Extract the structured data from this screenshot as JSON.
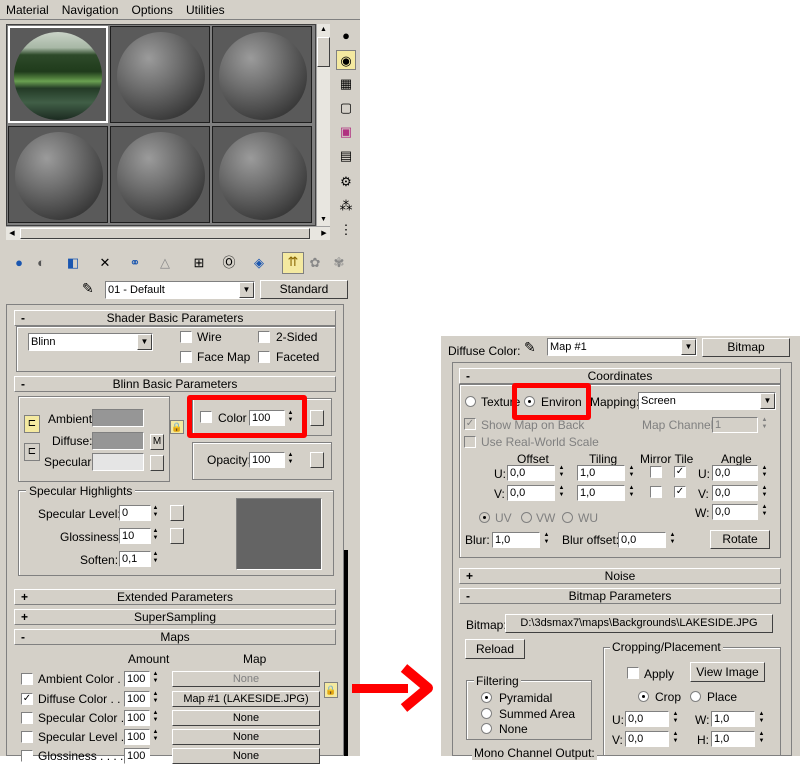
{
  "menu": [
    "Material",
    "Navigation",
    "Options",
    "Utilities"
  ],
  "material_name": "01 - Default",
  "material_type": "Standard",
  "shader_basic": {
    "title": "Shader Basic Parameters",
    "shader": "Blinn",
    "wire": "Wire",
    "two_sided": "2-Sided",
    "face_map": "Face Map",
    "faceted": "Faceted"
  },
  "blinn_basic": {
    "title": "Blinn Basic Parameters",
    "ambient": "Ambient:",
    "diffuse": "Diffuse:",
    "specular": "Specular:",
    "m_label": "M",
    "self_illum_label": "Color",
    "self_illum_value": "100",
    "opacity_label": "Opacity:",
    "opacity_value": "100",
    "colors": {
      "ambient": "#969696",
      "diffuse": "#969696",
      "specular": "#e5e5e5",
      "highlight": "#646464"
    }
  },
  "specular_highlights": {
    "title": "Specular Highlights",
    "level_label": "Specular Level:",
    "level": "0",
    "gloss_label": "Glossiness:",
    "gloss": "10",
    "soften_label": "Soften:",
    "soften": "0,1"
  },
  "rollouts": {
    "extended": "Extended Parameters",
    "supersampling": "SuperSampling",
    "maps": "Maps"
  },
  "maps": {
    "amount_header": "Amount",
    "map_header": "Map",
    "rows": [
      {
        "label": "Ambient Color . .",
        "checked": false,
        "amount": "100",
        "map": "None",
        "map_disabled": true
      },
      {
        "label": "Diffuse Color . . .",
        "checked": true,
        "amount": "100",
        "map": "Map #1 (LAKESIDE.JPG)",
        "map_disabled": false
      },
      {
        "label": "Specular Color . .",
        "checked": false,
        "amount": "100",
        "map": "None",
        "map_disabled": false
      },
      {
        "label": "Specular Level . .",
        "checked": false,
        "amount": "100",
        "map": "None",
        "map_disabled": false
      },
      {
        "label": "Glossiness . . . .",
        "checked": false,
        "amount": "100",
        "map": "None",
        "map_disabled": false
      }
    ]
  },
  "right": {
    "diffuse_color_label": "Diffuse Color:",
    "map_name": "Map #1",
    "map_type": "Bitmap",
    "coordinates_title": "Coordinates",
    "texture": "Texture",
    "environ": "Environ",
    "mapping_label": "Mapping:",
    "mapping_value": "Screen",
    "show_map": "Show Map on Back",
    "map_channel_label": "Map Channel:",
    "map_channel_value": "1",
    "use_real_world": "Use Real-World Scale",
    "offset": "Offset",
    "tiling": "Tiling",
    "mirror_tile": "Mirror Tile",
    "angle": "Angle",
    "u_label": "U:",
    "v_label": "V:",
    "w_label": "W:",
    "offset_u": "0,0",
    "offset_v": "0,0",
    "tiling_u": "1,0",
    "tiling_v": "1,0",
    "angle_u": "0,0",
    "angle_v": "0,0",
    "angle_w": "0,0",
    "uv": "UV",
    "vw": "VW",
    "wu": "WU",
    "blur_label": "Blur:",
    "blur": "1,0",
    "blur_offset_label": "Blur offset:",
    "blur_offset": "0,0",
    "rotate": "Rotate",
    "noise_title": "Noise",
    "bitmap_params_title": "Bitmap Parameters",
    "bitmap_label": "Bitmap:",
    "bitmap_path": "D:\\3dsmax7\\maps\\Backgrounds\\LAKESIDE.JPG",
    "reload": "Reload",
    "cropping_title": "Cropping/Placement",
    "apply": "Apply",
    "view_image": "View Image",
    "crop": "Crop",
    "place": "Place",
    "crop_u": "0,0",
    "crop_v": "0,0",
    "crop_w": "1,0",
    "crop_h": "1,0",
    "h_label": "H:",
    "filtering_title": "Filtering",
    "pyramidal": "Pyramidal",
    "summed_area": "Summed Area",
    "none": "None",
    "mono_channel": "Mono Channel Output:"
  }
}
